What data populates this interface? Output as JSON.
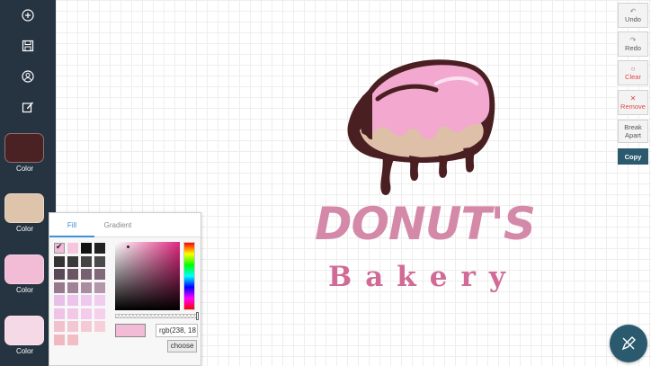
{
  "toolbar": {
    "tools": [
      {
        "icon": "add-icon"
      },
      {
        "icon": "save-icon"
      },
      {
        "icon": "layers-icon"
      },
      {
        "icon": "edit-icon"
      }
    ],
    "swatches": [
      {
        "label": "Color",
        "color": "#4a2223"
      },
      {
        "label": "Color",
        "color": "#dec4ab"
      },
      {
        "label": "Color",
        "color": "#f2bbd6"
      },
      {
        "label": "Color",
        "color": "#f6d9e7"
      }
    ]
  },
  "actions": {
    "undo": "Undo",
    "redo": "Redo",
    "clear": "Clear",
    "remove": "Remove",
    "break_apart": "Break Apart",
    "copy": "Copy"
  },
  "picker": {
    "tabs": [
      "Fill",
      "Gradient"
    ],
    "active_tab": "Fill",
    "value": "rgb(238, 18",
    "choose_label": "choose",
    "preview_color": "#f2bbd6",
    "palette": [
      [
        "#f2bbd6",
        "#f5c6dc",
        "#111111",
        "#222222"
      ],
      [
        "#333333",
        "#3a3a3a",
        "#444444",
        "#4a4a4a"
      ],
      [
        "#5a4a55",
        "#6a5563",
        "#77606f",
        "#806878"
      ],
      [
        "#97788c",
        "#a08296",
        "#a98ca0",
        "#b396aa"
      ],
      [
        "#e8bfe6",
        "#ecc3ea",
        "#efc8ee",
        "#f0ccef"
      ],
      [
        "#f0c2e6",
        "#f2c7e8",
        "#f4cbea",
        "#f6cfec"
      ],
      [
        "#f1c1cf",
        "#f3c6d3",
        "#f5cad7",
        "#f7cfdb"
      ],
      [
        "#f0b9c1",
        "#f2bec6"
      ]
    ]
  },
  "logo": {
    "title": "DONUT'S",
    "subtitle": "Bakery"
  },
  "colors": {
    "sidebar": "#263442",
    "accent": "#2b5a6e",
    "logo_title": "#d489a9",
    "logo_subtitle": "#d16a96",
    "chocolate": "#4a1f22",
    "icing": "#f2a8cf",
    "dough": "#dec0a8"
  }
}
